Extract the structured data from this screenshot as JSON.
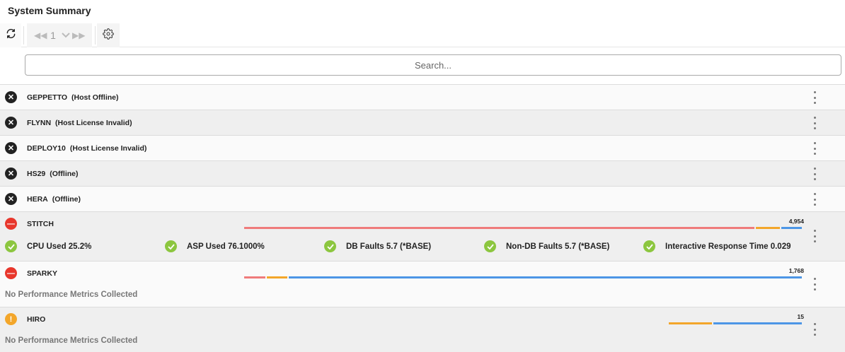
{
  "page": {
    "title": "System Summary"
  },
  "toolbar": {
    "refresh_icon": "refresh-icon",
    "pager_first_icon": "double-chevron-left-icon",
    "pager_page": "1",
    "pager_dropdown_icon": "chevron-down-icon",
    "pager_next_icon": "double-chevron-right-icon",
    "settings_icon": "gear-icon"
  },
  "search": {
    "placeholder": "Search..."
  },
  "colors": {
    "offline": "#222222",
    "critical": "#e8372c",
    "warning": "#f3a62a",
    "ok": "#8cc63f",
    "bar_red": "#ef7b7b",
    "bar_orange": "#f3a62a",
    "bar_blue": "#4d96e6"
  },
  "hosts": [
    {
      "name": "GEPPETTO",
      "status": "(Host Offline)",
      "icon": "offline-x-icon"
    },
    {
      "name": "FLYNN",
      "status": "(Host License Invalid)",
      "icon": "offline-x-icon"
    },
    {
      "name": "DEPLOY10",
      "status": "(Host License Invalid)",
      "icon": "offline-x-icon"
    },
    {
      "name": "HS29",
      "status": "(Offline)",
      "icon": "offline-x-icon"
    },
    {
      "name": "HERA",
      "status": "(Offline)",
      "icon": "offline-x-icon"
    },
    {
      "name": "STITCH",
      "icon": "critical-minus-icon",
      "total": "4,954",
      "breakdown": {
        "red": 0.915,
        "orange": 0.046,
        "blue": 0.039
      },
      "metrics": [
        {
          "label": "CPU Used 25.2%",
          "icon": "check-icon"
        },
        {
          "label": "ASP Used 76.1000%",
          "icon": "check-icon"
        },
        {
          "label": "DB Faults 5.7 (*BASE)",
          "icon": "check-icon"
        },
        {
          "label": "Non-DB Faults 5.7 (*BASE)",
          "icon": "check-icon"
        },
        {
          "label": "Interactive Response Time 0.029",
          "icon": "check-icon"
        }
      ]
    },
    {
      "name": "SPARKY",
      "icon": "critical-minus-icon",
      "total": "1,768",
      "breakdown": {
        "red": 0.04,
        "orange": 0.04,
        "blue": 0.92
      },
      "note": "No Performance Metrics Collected"
    },
    {
      "name": "HIRO",
      "icon": "warning-exclamation-icon",
      "total": "15",
      "breakdown": {
        "red": 0,
        "orange": 0.33,
        "blue": 0.67
      },
      "note": "No Performance Metrics Collected"
    }
  ]
}
